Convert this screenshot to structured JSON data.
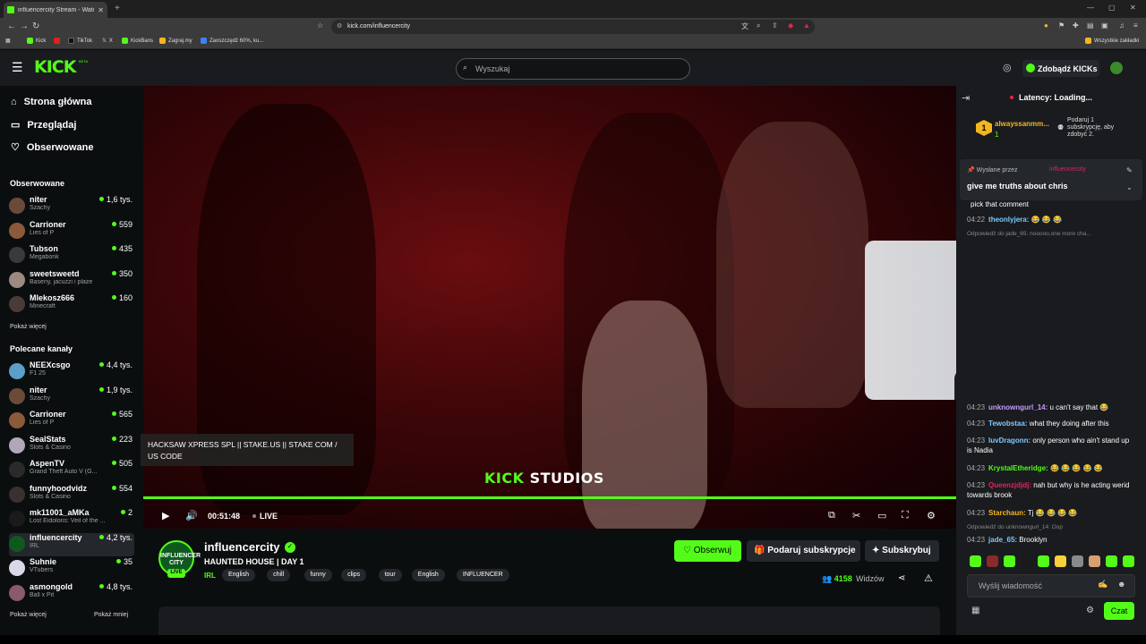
{
  "browser": {
    "tab_title": "influencercity Stream - Watch Li",
    "url": "kick.com/influencercity",
    "bookmarks": [
      {
        "label": "Kick",
        "color": "#53fc18"
      },
      {
        "label": "",
        "color": "#e02020"
      },
      {
        "label": "TikTok",
        "color": "#222222"
      },
      {
        "label": "X",
        "color": "#222222"
      },
      {
        "label": "KickBans",
        "color": "#53fc18"
      },
      {
        "label": "Zagraj.my",
        "color": "#f3b61f"
      },
      {
        "label": "Zaoszczędź 60%, ku...",
        "color": "#3b82f6"
      }
    ],
    "all_bookmarks": "Wszystkie zakładki"
  },
  "header": {
    "logo": "KICK",
    "logo_tag": "BETA",
    "search_placeholder": "Wyszukaj",
    "kicks_label": "Zdobądź KICKs"
  },
  "sidebar": {
    "nav": [
      {
        "label": "Strona główna",
        "icon": "home-icon"
      },
      {
        "label": "Przeglądaj",
        "icon": "browse-icon"
      },
      {
        "label": "Obserwowane",
        "icon": "heart-icon"
      }
    ],
    "followed_title": "Obserwowane",
    "followed": [
      {
        "name": "niter",
        "category": "Szachy",
        "viewers": "1,6 tys.",
        "color": "#6b4a3a"
      },
      {
        "name": "Carrioner",
        "category": "Lies of P",
        "viewers": "559",
        "color": "#8a5a3a"
      },
      {
        "name": "Tubson",
        "category": "Megabonk",
        "viewers": "435",
        "color": "#3a3a3a"
      },
      {
        "name": "sweetsweetd",
        "category": "Baseny, jacuzzi i plaże",
        "viewers": "350",
        "color": "#9a8a80"
      },
      {
        "name": "Mlekosz666",
        "category": "Minecraft",
        "viewers": "160",
        "color": "#4a3a3a"
      }
    ],
    "show_more": "Pokaż więcej",
    "recommended_title": "Polecane kanały",
    "recommended": [
      {
        "name": "NEEXcsgo",
        "category": "F1 25",
        "viewers": "4,4 tys.",
        "color": "#5aa0c8"
      },
      {
        "name": "niter",
        "category": "Szachy",
        "viewers": "1,9 tys.",
        "color": "#6b4a3a"
      },
      {
        "name": "Carrioner",
        "category": "Lies of P",
        "viewers": "565",
        "color": "#8a5a3a"
      },
      {
        "name": "SealStats",
        "category": "Slots & Casino",
        "viewers": "223",
        "color": "#b0a8b8"
      },
      {
        "name": "AspenTV",
        "category": "Grand Theft Auto V (G...",
        "viewers": "505",
        "color": "#2a2a2a"
      },
      {
        "name": "funnyhoodvidz",
        "category": "Slots & Casino",
        "viewers": "554",
        "color": "#3a3030"
      },
      {
        "name": "mk11001_aMKa",
        "category": "Lost Eidolons: Veil of the ...",
        "viewers": "2",
        "color": "#1a1a1a"
      },
      {
        "name": "influencercity",
        "category": "IRL",
        "viewers": "4,2 tys.",
        "color": "#0e5a1e"
      },
      {
        "name": "Suhnie",
        "category": "VTubers",
        "viewers": "35",
        "color": "#d8d8e8"
      },
      {
        "name": "asmongold",
        "category": "Ball x Pit",
        "viewers": "4,8 tys.",
        "color": "#8a5a6a"
      }
    ],
    "show_more2": "Pokaż więcej",
    "show_less": "Pokaż mniej"
  },
  "video": {
    "brand_k": "KICK",
    "brand_rest": "STUDIOS",
    "overlay_text": "HACKSAW XPRESS SPL || STAKE.US || STAKE COM / US CODE",
    "time": "00:51:48",
    "live": "LIVE",
    "progress": 1.0
  },
  "stream": {
    "avatar_text": "INFLUENCER CITY",
    "live_badge": "LIVE",
    "name": "influencercity",
    "title": "HAUNTED HOUSE | DAY 1",
    "category": "IRL",
    "tags": [
      "English",
      "chill",
      "funny",
      "clips",
      "tour",
      "English",
      "INFLUENCER"
    ],
    "follow": "Obserwuj",
    "gift": "Podaruj subskrypcje",
    "subscribe": "Subskrybuj",
    "viewers": "4158",
    "viewers_label": "Widzów"
  },
  "chat": {
    "latency": "Latency: Loading...",
    "gifter_name": "alwayssanmm...",
    "gifter_count": "1",
    "gift_rank": "1",
    "gift_hint": "Podaruj 1 subskrypcję, aby zdobyć 2.",
    "pinned_meta": "Wysłane przez",
    "pinned_user": "influencercity",
    "pinned_text": "give me truths about chris",
    "messages": [
      {
        "ts": "",
        "user": "",
        "color": "#fff",
        "text": "pick that comment"
      },
      {
        "ts": "04:22",
        "user": "theonlyjera:",
        "color": "#7fc8ff",
        "text": "😂 😂 😂"
      },
      {
        "reply": "Odpowiedź do jade_65: nooooo,one more cha..."
      },
      {
        "ts": "04:23",
        "user": "unknowngurl_14:",
        "color": "#c39bff",
        "text": "u can't say that 😂"
      },
      {
        "ts": "04:23",
        "user": "Tewobstaa:",
        "color": "#7fc8ff",
        "text": "what they doing after this"
      },
      {
        "ts": "04:23",
        "user": "luvDragonn:",
        "color": "#7fc8ff",
        "text": "only person who ain't stand up is Nadia"
      },
      {
        "ts": "04:23",
        "user": "KrystalEtheridge:",
        "color": "#53fc18",
        "text": "😂 😂 😂 😂 😂"
      },
      {
        "ts": "04:23",
        "user": "Queenzjdjdj:",
        "color": "#e0245e",
        "text": "nah but why is he acting werid towards brook"
      },
      {
        "ts": "04:23",
        "user": "Starchaun:",
        "color": "#f3b61f",
        "text": "Tj 😂 😂 😂 😂"
      },
      {
        "reply": "Odpowiedź do unknowngurl_14: Oop"
      },
      {
        "ts": "04:23",
        "user": "jade_65:",
        "color": "#7fc8ff",
        "text": "Brooklyn"
      }
    ],
    "input_placeholder": "Wyślij wiadomość",
    "send": "Czat"
  }
}
